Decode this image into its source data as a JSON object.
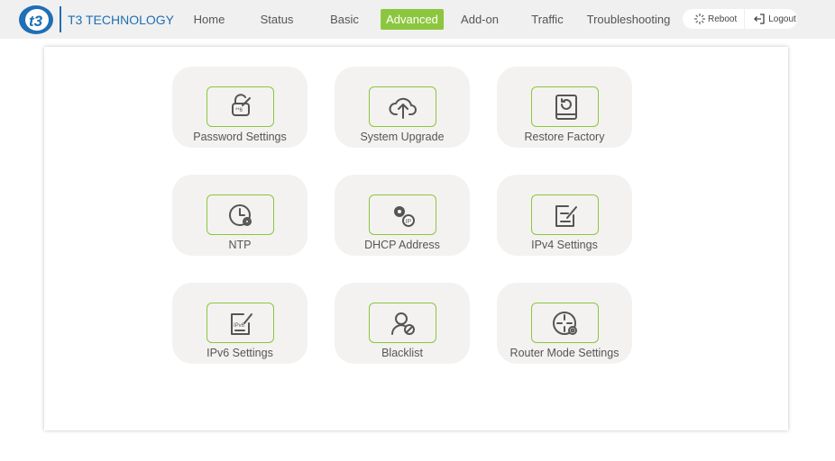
{
  "header": {
    "brand": "T3 TECHNOLOGY",
    "logo_text": "t3",
    "nav": [
      {
        "label": "Home"
      },
      {
        "label": "Status"
      },
      {
        "label": "Basic"
      },
      {
        "label": "Advanced",
        "active": true
      },
      {
        "label": "Add-on"
      },
      {
        "label": "Traffic"
      },
      {
        "label": "Troubleshooting"
      }
    ],
    "reboot": "Reboot",
    "logout": "Logout"
  },
  "colors": {
    "accent": "#8cc63f",
    "brand": "#1f6fb5"
  },
  "tiles": [
    {
      "label": "Password Settings",
      "icon": "lock-edit-icon"
    },
    {
      "label": "System Upgrade",
      "icon": "cloud-upload-icon"
    },
    {
      "label": "Restore Factory",
      "icon": "restore-icon"
    },
    {
      "label": "NTP",
      "icon": "clock-gear-icon"
    },
    {
      "label": "DHCP Address",
      "icon": "gear-ip-icon"
    },
    {
      "label": "IPv4 Settings",
      "icon": "edit-doc-icon"
    },
    {
      "label": "IPv6 Settings",
      "icon": "ipv6-doc-icon"
    },
    {
      "label": "Blacklist",
      "icon": "user-block-icon"
    },
    {
      "label": "Router Mode Settings",
      "icon": "router-gear-icon"
    }
  ]
}
